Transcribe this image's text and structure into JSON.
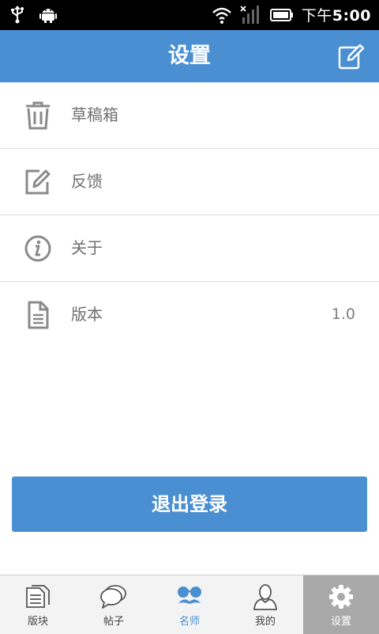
{
  "status_bar": {
    "time_prefix": "下午",
    "time": "5:00"
  },
  "header": {
    "title": "设置",
    "edit_icon": "compose-icon"
  },
  "settings_items": [
    {
      "icon": "trash-icon",
      "label": "草稿箱",
      "value": ""
    },
    {
      "icon": "edit-icon",
      "label": "反馈",
      "value": ""
    },
    {
      "icon": "info-icon",
      "label": "关于",
      "value": ""
    },
    {
      "icon": "document-icon",
      "label": "版本",
      "value": "1.0"
    }
  ],
  "logout_label": "退出登录",
  "tabs": [
    {
      "icon": "forum-icon",
      "label": "版块",
      "state": "normal"
    },
    {
      "icon": "chat-bubbles-icon",
      "label": "帖子",
      "state": "normal"
    },
    {
      "icon": "mustache-glasses-icon",
      "label": "名师",
      "state": "highlight"
    },
    {
      "icon": "person-icon",
      "label": "我的",
      "state": "normal"
    },
    {
      "icon": "gear-icon",
      "label": "设置",
      "state": "selected"
    }
  ],
  "colors": {
    "accent": "#4a8fd1",
    "tab_selected_bg": "#a9a9a9"
  }
}
